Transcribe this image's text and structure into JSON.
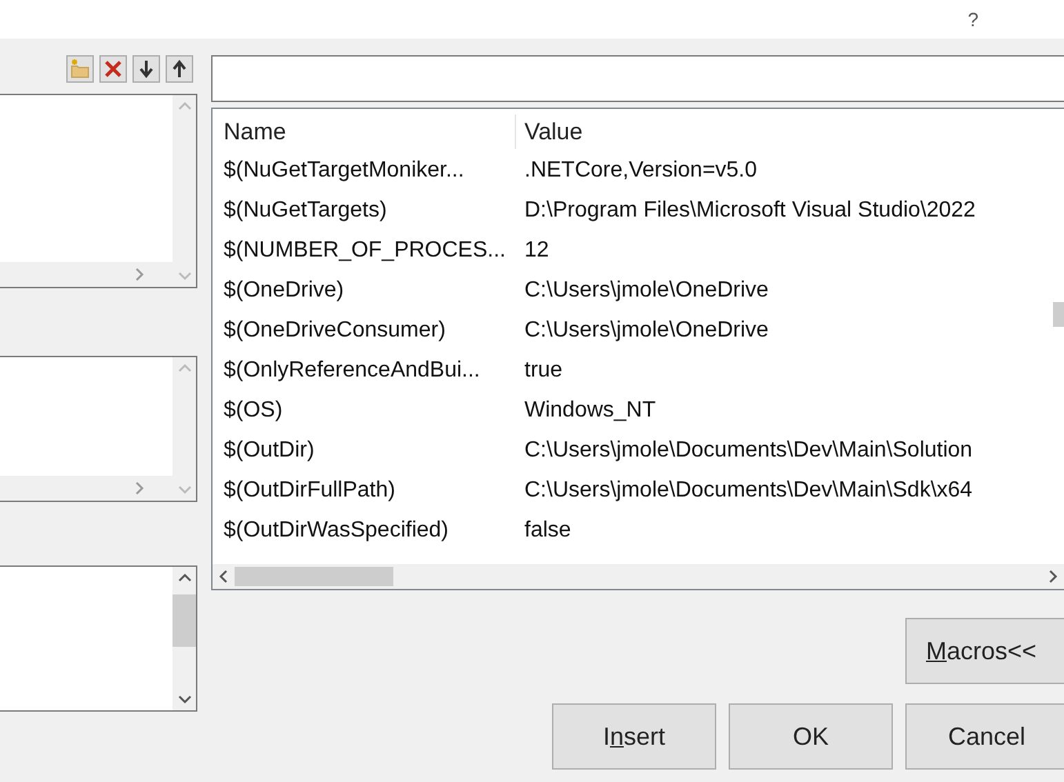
{
  "title_bar": {
    "help": "?"
  },
  "toolbar": [
    {
      "kind": "new-folder"
    },
    {
      "kind": "delete"
    },
    {
      "kind": "down"
    },
    {
      "kind": "up"
    }
  ],
  "table": {
    "columns": [
      "Name",
      "Value"
    ],
    "rows": [
      {
        "name": "$(NuGetTargetMoniker...",
        "value": ".NETCore,Version=v5.0"
      },
      {
        "name": "$(NuGetTargets)",
        "value": "D:\\Program Files\\Microsoft Visual Studio\\2022"
      },
      {
        "name": "$(NUMBER_OF_PROCES...",
        "value": "12"
      },
      {
        "name": "$(OneDrive)",
        "value": "C:\\Users\\jmole\\OneDrive"
      },
      {
        "name": "$(OneDriveConsumer)",
        "value": "C:\\Users\\jmole\\OneDrive"
      },
      {
        "name": "$(OnlyReferenceAndBui...",
        "value": "true"
      },
      {
        "name": "$(OS)",
        "value": "Windows_NT"
      },
      {
        "name": "$(OutDir)",
        "value": "C:\\Users\\jmole\\Documents\\Dev\\Main\\Solution"
      },
      {
        "name": "$(OutDirFullPath)",
        "value": "C:\\Users\\jmole\\Documents\\Dev\\Main\\Sdk\\x64"
      },
      {
        "name": "$(OutDirWasSpecified)",
        "value": "false"
      }
    ]
  },
  "buttons": [
    {
      "kind": "macros",
      "access_key": "M",
      "label_after": "acros<<"
    },
    {
      "kind": "insert",
      "label_before": "I",
      "access_key": "n",
      "label_after": "sert"
    },
    {
      "kind": "ok",
      "label_before": "OK"
    },
    {
      "kind": "cancel",
      "label_before": "Cancel"
    }
  ]
}
